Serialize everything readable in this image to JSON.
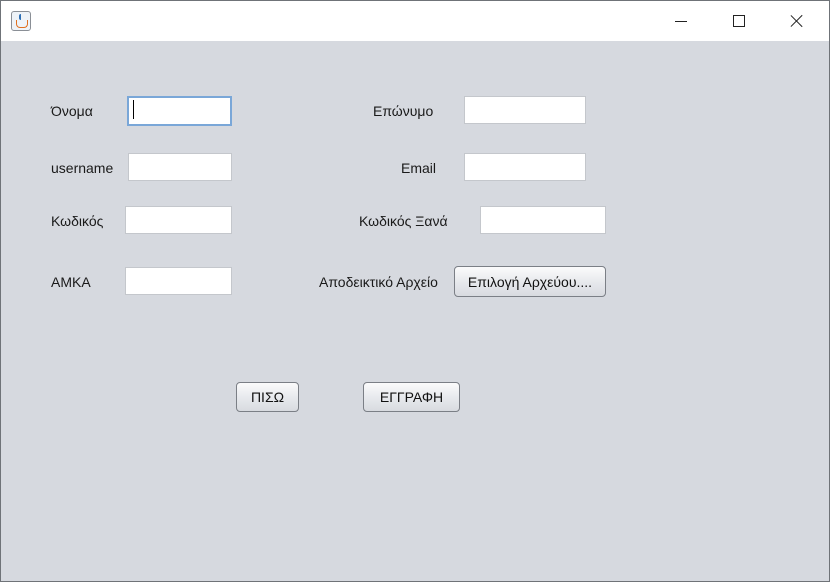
{
  "titlebar": {
    "icon": "java-cup-icon",
    "controls": {
      "minimize": "minimize-icon",
      "maximize": "maximize-icon",
      "close": "close-icon"
    }
  },
  "form": {
    "first_name": {
      "label": "Όνομα",
      "value": ""
    },
    "last_name": {
      "label": "Επώνυμο",
      "value": ""
    },
    "username": {
      "label": "username",
      "value": ""
    },
    "email": {
      "label": "Email",
      "value": ""
    },
    "password": {
      "label": "Κωδικός",
      "value": ""
    },
    "password_confirm": {
      "label": "Κωδικός Ξανά",
      "value": ""
    },
    "amka": {
      "label": "ΑΜΚΑ",
      "value": ""
    },
    "proof_file": {
      "label": "Αποδεικτικό Αρχείο",
      "button_label": "Επιλογή Αρχεύου...."
    }
  },
  "actions": {
    "back_label": "ΠΙΣΩ",
    "register_label": "ΕΓΓΡΑΦΗ"
  }
}
